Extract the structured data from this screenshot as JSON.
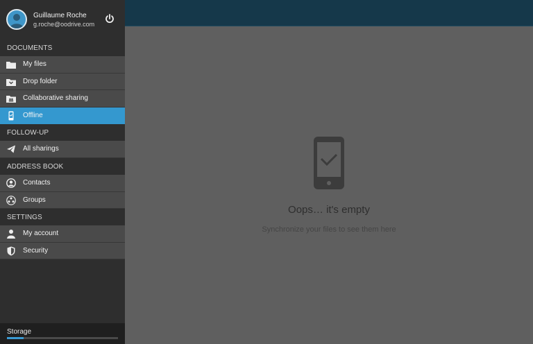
{
  "user": {
    "name": "Guillaume Roche",
    "email": "g.roche@oodrive.com"
  },
  "menu": {
    "documents_header": "DOCUMENTS",
    "my_files": "My files",
    "drop_folder": "Drop folder",
    "collaborative_sharing": "Collaborative sharing",
    "offline": "Offline",
    "followup_header": "FOLLOW-UP",
    "all_sharings": "All sharings",
    "addressbook_header": "ADDRESS BOOK",
    "contacts": "Contacts",
    "groups": "Groups",
    "settings_header": "SETTINGS",
    "my_account": "My account",
    "security": "Security"
  },
  "storage": {
    "label": "Storage",
    "used_fraction": 0.15
  },
  "empty_state": {
    "title": "Oops… it's empty",
    "subtitle": "Synchronize your files to see them here"
  },
  "colors": {
    "accent": "#3498cf",
    "topbar": "#15384a",
    "sidebar": "#2e2e2e",
    "item": "#4a4a4a"
  },
  "icons": {
    "power": "power-icon",
    "my_files": "folder-icon",
    "drop_folder": "drop-folder-icon",
    "collaborative": "shared-folder-icon",
    "offline": "phone-check-icon",
    "all_sharings": "send-icon",
    "contacts": "contact-circle-icon",
    "groups": "groups-icon",
    "my_account": "person-icon",
    "security": "shield-icon",
    "empty": "phone-check-icon"
  }
}
